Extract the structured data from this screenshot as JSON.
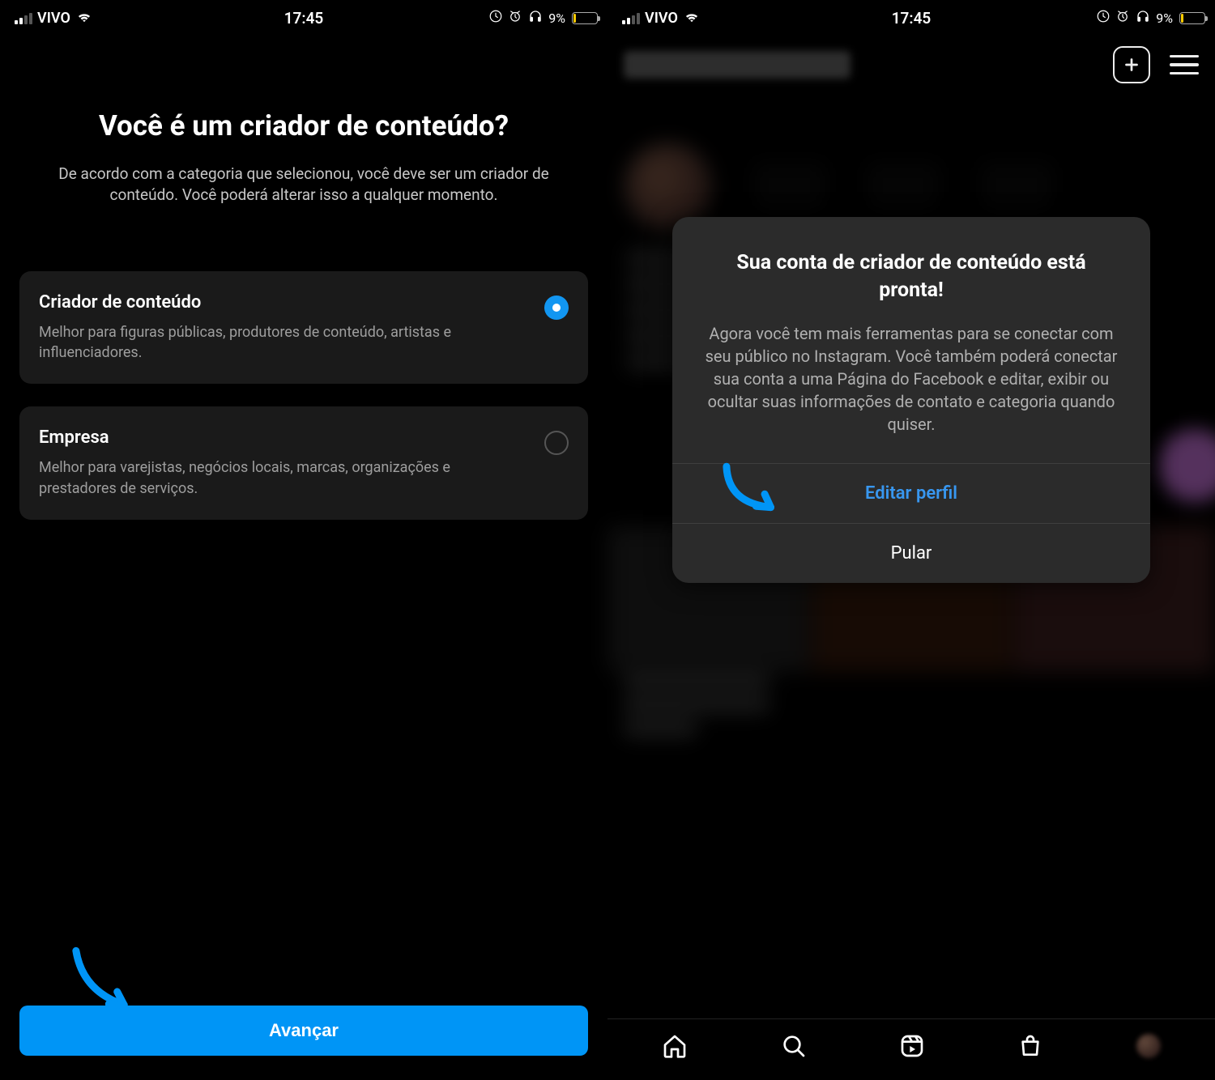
{
  "status": {
    "carrier": "VIVO",
    "time": "17:45",
    "battery": "9%"
  },
  "left": {
    "title": "Você é um criador de conteúdo?",
    "subtitle": "De acordo com a categoria que selecionou, você deve ser um criador de conteúdo. Você poderá alterar isso a qualquer momento.",
    "options": [
      {
        "title": "Criador de conteúdo",
        "desc": "Melhor para figuras públicas, produtores de conteúdo, artistas e influenciadores.",
        "selected": true
      },
      {
        "title": "Empresa",
        "desc": "Melhor para varejistas, negócios locais, marcas, organizações e prestadores de serviços.",
        "selected": false
      }
    ],
    "cta": "Avançar"
  },
  "right": {
    "modal": {
      "title": "Sua conta de criador de conteúdo está pronta!",
      "desc": "Agora você tem mais ferramentas para se conectar com seu público no Instagram. Você também poderá conectar sua conta a uma Página do Facebook e editar, exibir ou ocultar suas informações de contato e categoria quando quiser.",
      "primary": "Editar perfil",
      "secondary": "Pular"
    }
  }
}
